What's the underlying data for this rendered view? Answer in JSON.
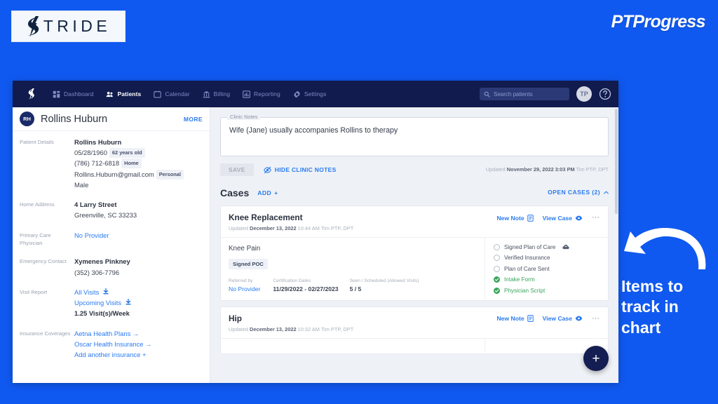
{
  "branding": {
    "stride_logo_text": "TRIDE",
    "stride_icon": "lightning-s-icon",
    "ptprogress_text": "PTProgress"
  },
  "annotation": {
    "icon": "curved-arrow-left-icon",
    "line1": "Items to",
    "line2": "track in",
    "line3": "chart"
  },
  "navbar": {
    "brand_icon": "stride-bolt-icon",
    "items": [
      {
        "label": "Dashboard",
        "icon": "grid-icon",
        "active": false
      },
      {
        "label": "Patients",
        "icon": "people-icon",
        "active": true
      },
      {
        "label": "Calendar",
        "icon": "calendar-icon",
        "active": false
      },
      {
        "label": "Billing",
        "icon": "bank-icon",
        "active": false
      },
      {
        "label": "Reporting",
        "icon": "bar-chart-icon",
        "active": false
      },
      {
        "label": "Settings",
        "icon": "gear-icon",
        "active": false
      }
    ],
    "search_placeholder": "Search patients",
    "search_icon": "search-icon",
    "avatar_initials": "TP",
    "help_icon": "question-circle-icon"
  },
  "sidebar": {
    "avatar_initials": "RH",
    "patient_name": "Rollins Huburn",
    "more_label": "MORE",
    "details": {
      "label": "Patient Details",
      "name": "Rollins Huburn",
      "dob": "05/28/1960",
      "age_chip": "62 years old",
      "phone": "(786) 712-6818",
      "phone_chip": "Home",
      "email": "Rollins.Huburn@gmail.com",
      "email_chip": "Personal",
      "gender": "Male"
    },
    "home_address": {
      "label": "Home Address",
      "line1": "4 Larry Street",
      "line2": "Greenville, SC 33233"
    },
    "primary_care": {
      "label": "Primary Care Physician",
      "value": "No Provider"
    },
    "emergency_contact": {
      "label": "Emergency Contact",
      "name": "Xymenes Pinkney",
      "phone": "(352) 306-7796"
    },
    "visit_report": {
      "label": "Visit Report",
      "all_visits": "All Visits",
      "upcoming_visits": "Upcoming Visits",
      "frequency": "1.25 Visit(s)/Week",
      "download_icon": "download-icon"
    },
    "insurance": {
      "label": "Insurance Coverages",
      "items": [
        "Aetna Health Plans",
        "Oscar Health Insurance"
      ],
      "add_label": "Add another insurance",
      "arrow_icon": "arrow-right-icon",
      "plus_icon": "plus-icon"
    }
  },
  "clinic_notes": {
    "legend": "Clinic Notes",
    "value": "Wife (Jane) usually accompanies Rollins to therapy",
    "save_label": "SAVE",
    "hide_label": "HIDE CLINIC NOTES",
    "hide_icon": "eye-off-icon",
    "updated_prefix": "Updated",
    "updated_date": "November 29, 2022 3:03 PM",
    "updated_author": "Tim PTP, DPT"
  },
  "cases": {
    "title": "Cases",
    "add_label": "ADD",
    "add_icon": "plus-icon",
    "open_cases_label": "OPEN CASES (2)",
    "open_cases_icon": "chevron-up-icon",
    "new_note_label": "New Note",
    "new_note_icon": "note-icon",
    "view_case_label": "View Case",
    "view_case_icon": "eye-icon",
    "overflow_icon": "ellipsis-icon",
    "items": [
      {
        "name": "Knee Replacement",
        "updated_prefix": "Updated",
        "updated_date": "December 13, 2022",
        "updated_time": "10:44 AM",
        "updated_author": "Tim PTP, DPT",
        "condition": "Knee Pain",
        "status_chip": "Signed POC",
        "meta": [
          {
            "label": "Referred by",
            "value": "No Provider",
            "link": true
          },
          {
            "label": "Certification Dates",
            "value": "11/29/2022 - 02/27/2023",
            "link": false
          },
          {
            "label": "Seen / Scheduled (Allowed Visits)",
            "value": "5 / 5",
            "link": false
          }
        ],
        "checklist": [
          {
            "label": "Signed Plan of Care",
            "done": false,
            "extra_icon": "cloud-upload-icon"
          },
          {
            "label": "Verified Insurance",
            "done": false
          },
          {
            "label": "Plan of Care Sent",
            "done": false
          },
          {
            "label": "Intake Form",
            "done": true
          },
          {
            "label": "Physician Script",
            "done": true
          }
        ]
      },
      {
        "name": "Hip",
        "updated_prefix": "Updated",
        "updated_date": "December 13, 2022",
        "updated_time": "10:32 AM",
        "updated_author": "Tim PTP, DPT"
      }
    ]
  },
  "fab": {
    "icon": "plus-icon",
    "label": "+"
  },
  "colors": {
    "page_blue": "#1059f0",
    "nav_navy": "#111b4d",
    "link_blue": "#2a7bf0",
    "done_green": "#3aa45c"
  }
}
